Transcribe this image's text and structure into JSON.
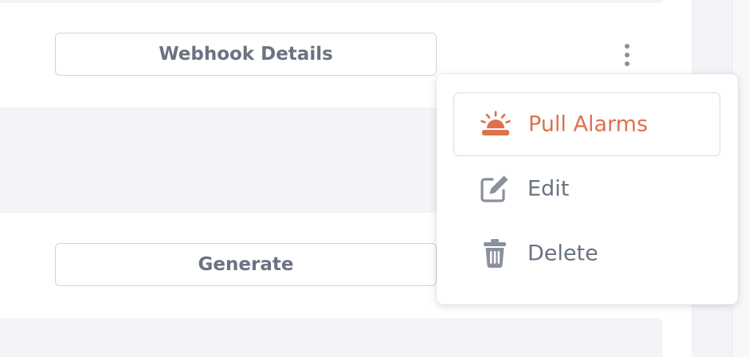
{
  "buttons": {
    "webhook_details": "Webhook Details",
    "generate": "Generate"
  },
  "more_menu": {
    "trigger_icon": "kebab-vertical-icon",
    "items": [
      {
        "label": "Pull Alarms",
        "icon": "siren-icon",
        "highlighted": true
      },
      {
        "label": "Edit",
        "icon": "edit-icon",
        "highlighted": false
      },
      {
        "label": "Delete",
        "icon": "trash-icon",
        "highlighted": false
      }
    ]
  },
  "colors": {
    "accent": "#e0704b",
    "text_muted": "#6b7280",
    "icon_gray": "#8a909c",
    "band_bg": "#f3f4f7"
  }
}
